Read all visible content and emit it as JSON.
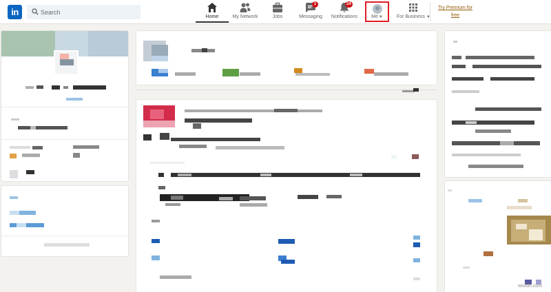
{
  "nav": {
    "logo_text": "in",
    "search_placeholder": "Search",
    "items": [
      {
        "label": "Home",
        "icon": "home-icon",
        "active": true
      },
      {
        "label": "My Network",
        "icon": "people-icon"
      },
      {
        "label": "Jobs",
        "icon": "briefcase-icon"
      },
      {
        "label": "Messaging",
        "icon": "chat-icon",
        "badge": "1"
      },
      {
        "label": "Notifications",
        "icon": "bell-icon",
        "badge": "24"
      },
      {
        "label": "Me",
        "icon": "avatar-icon",
        "highlighted": true
      },
      {
        "label": "For Business",
        "icon": "grid-icon"
      }
    ],
    "premium_line1": "Try Premium for",
    "premium_line2": "free"
  },
  "watermark": "wsxdn.com",
  "colors": {
    "brand": "#0a66c2",
    "badge": "#cc1016",
    "highlight_box": "#e01b24",
    "premium": "#915907"
  }
}
